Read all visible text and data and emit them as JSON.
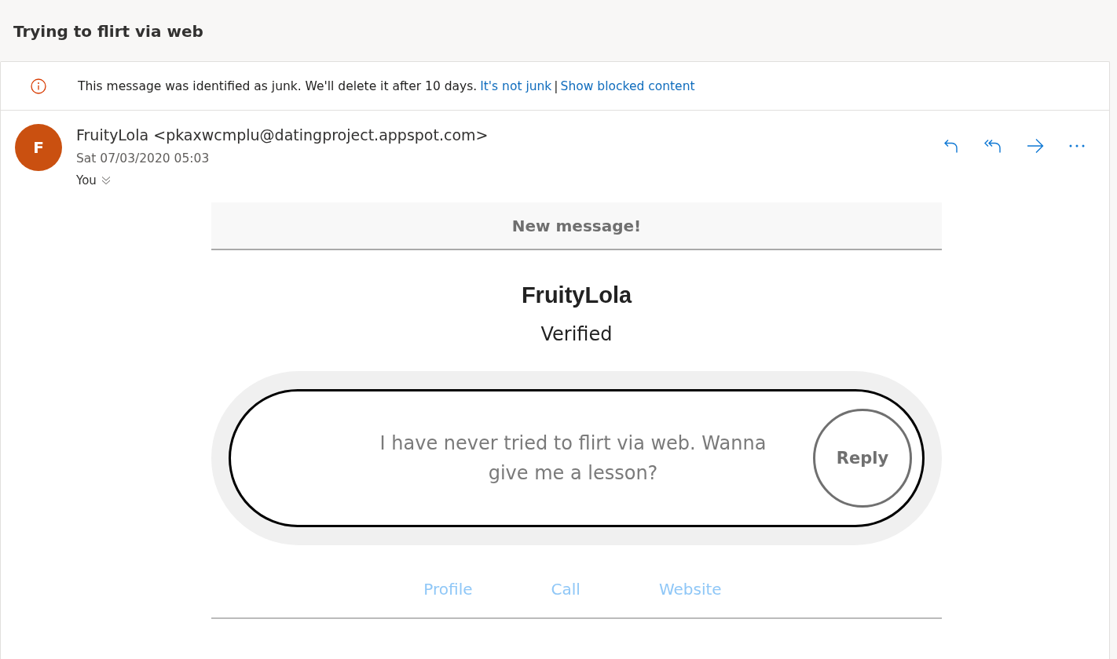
{
  "subject": "Trying to flirt via web",
  "junk_banner": {
    "message": "This message was identified as junk. We'll delete it after 10 days.",
    "links": [
      "It's not junk",
      "Show blocked content"
    ],
    "separator": "|"
  },
  "sender": {
    "initial": "F",
    "from": "FruityLola <pkaxwcmplu@datingproject.appspot.com>",
    "date": "Sat 07/03/2020 05:03",
    "to": "You"
  },
  "body": {
    "header": "New message!",
    "name": "FruityLola",
    "status": "Verified",
    "message": "I have never tried to flirt via web. Wanna give me a lesson?",
    "reply_button": "Reply",
    "links": [
      "Profile",
      "Call",
      "Website"
    ]
  }
}
